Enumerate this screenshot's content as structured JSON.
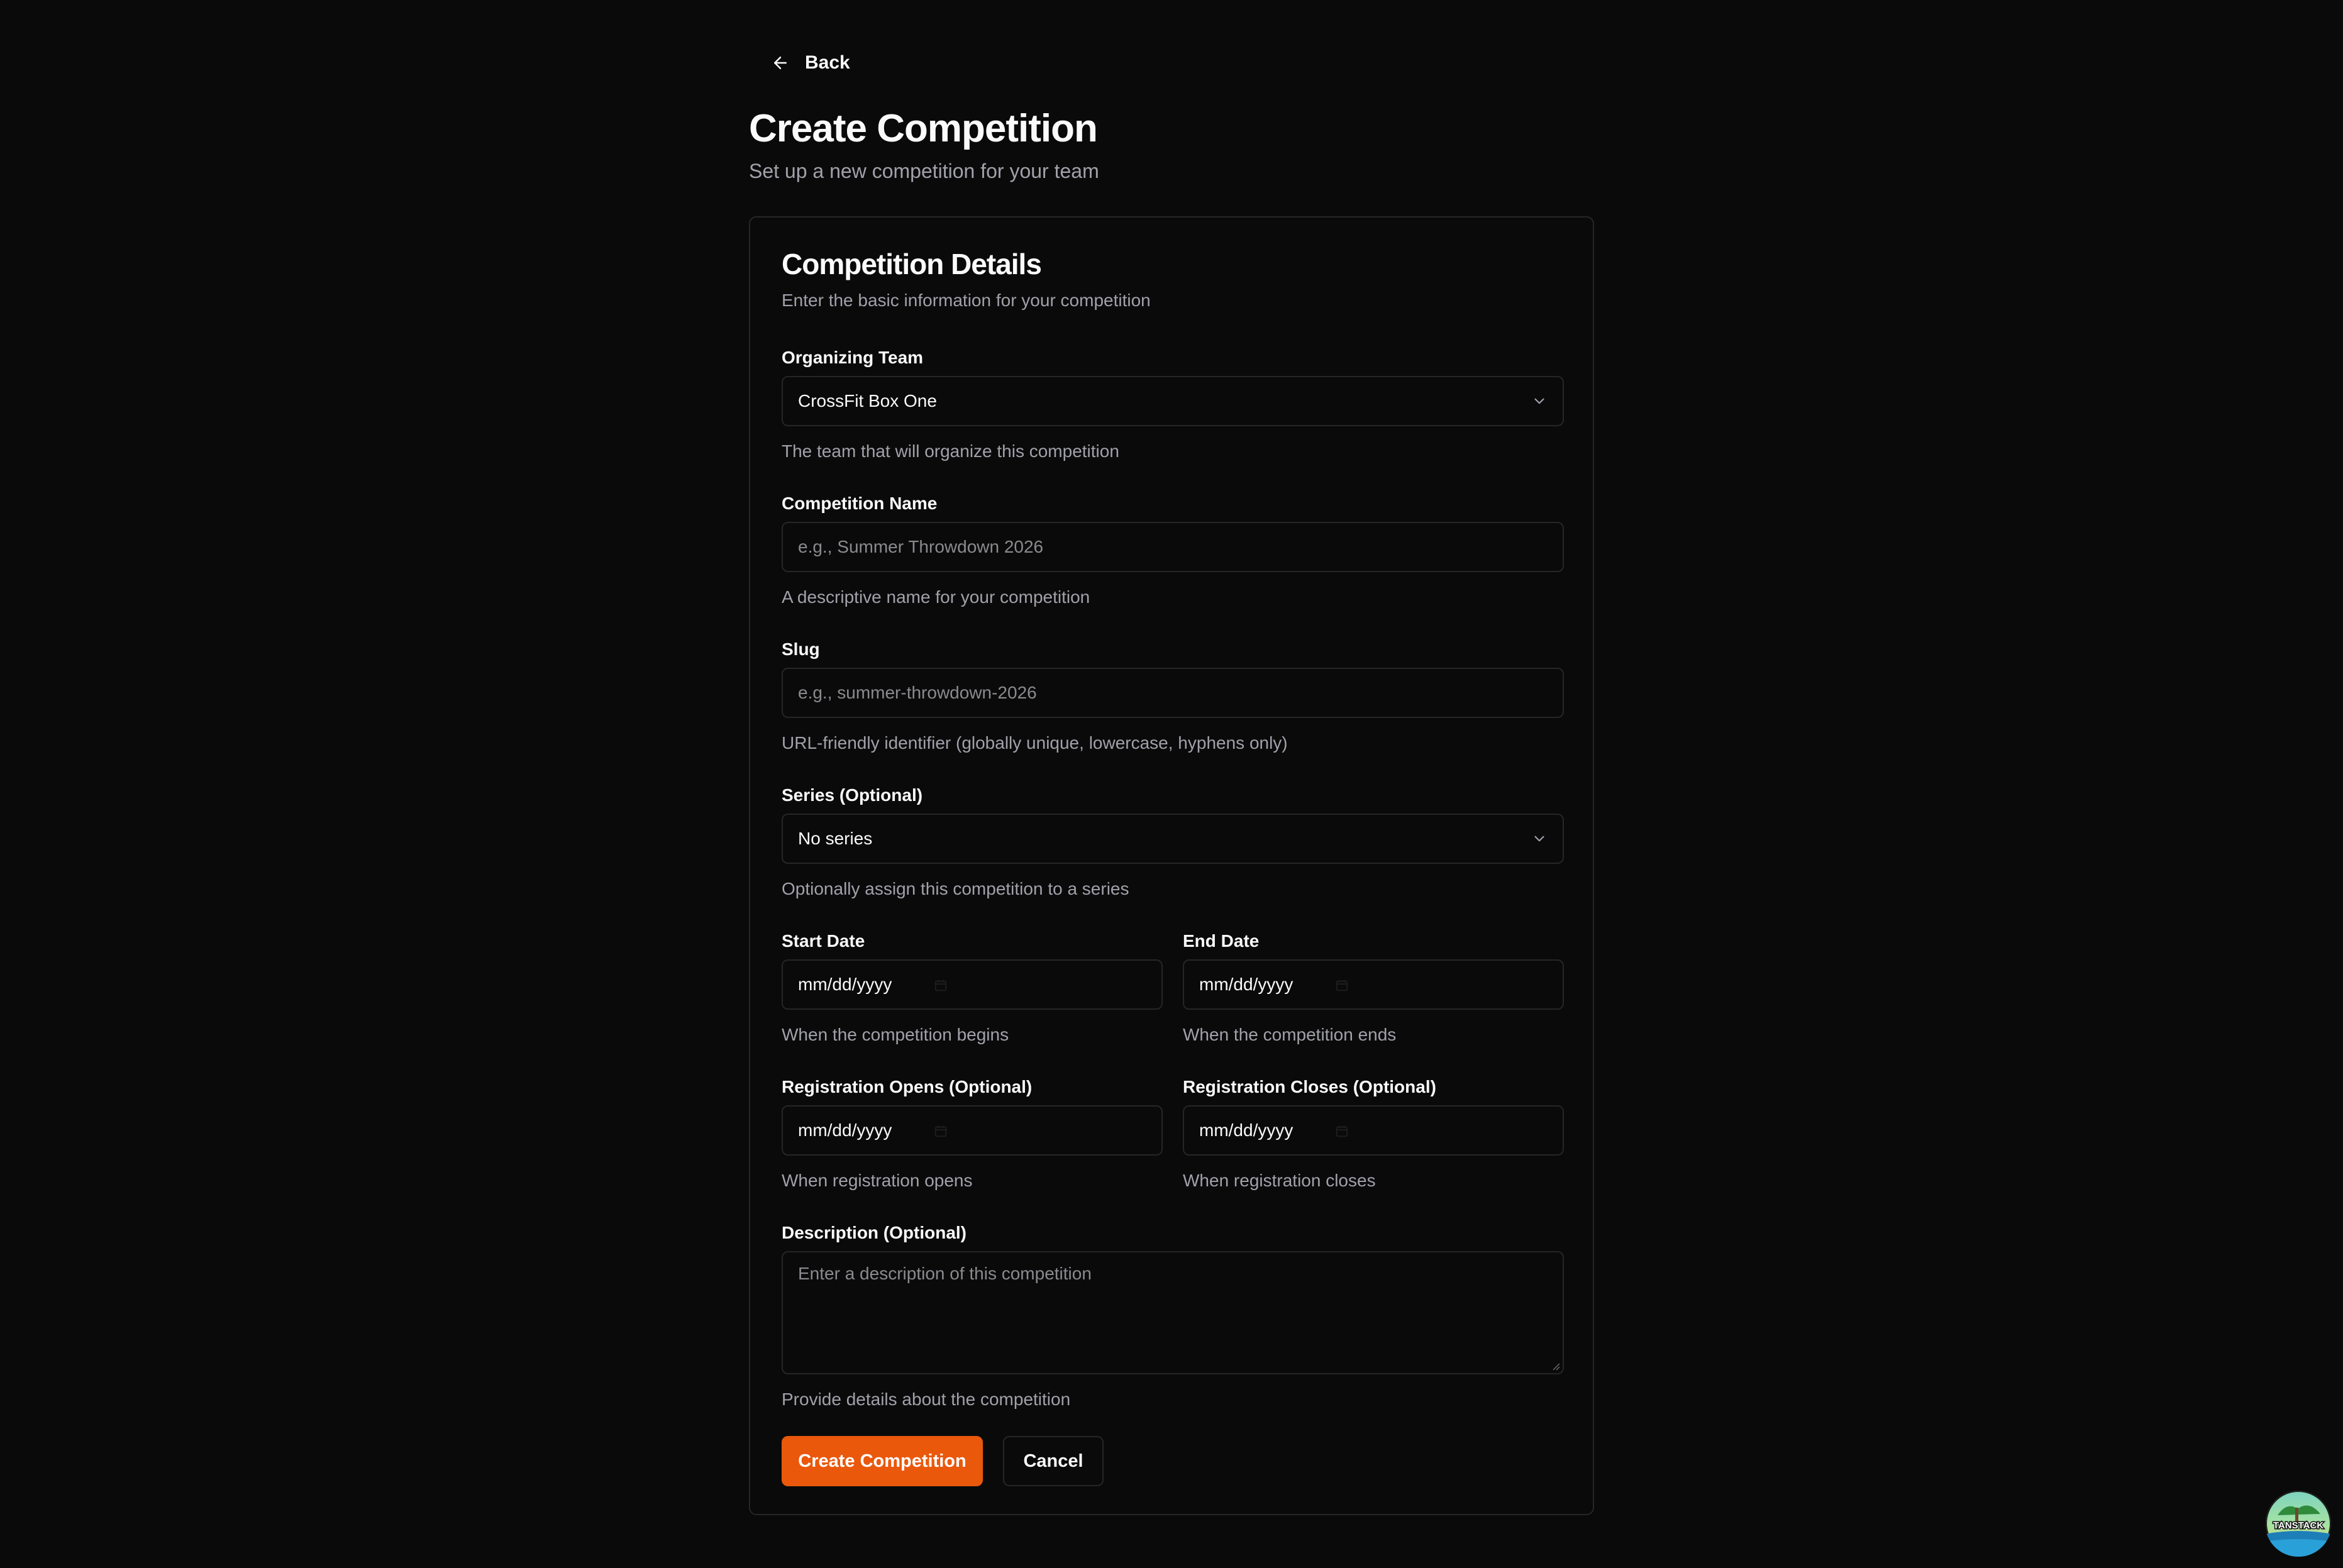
{
  "back": {
    "label": "Back"
  },
  "header": {
    "title": "Create Competition",
    "subtitle": "Set up a new competition for your team"
  },
  "card": {
    "title": "Competition Details",
    "description": "Enter the basic information for your competition"
  },
  "fields": {
    "organizing_team": {
      "label": "Organizing Team",
      "value": "CrossFit Box One",
      "help": "The team that will organize this competition"
    },
    "competition_name": {
      "label": "Competition Name",
      "placeholder": "e.g., Summer Throwdown 2026",
      "help": "A descriptive name for your competition"
    },
    "slug": {
      "label": "Slug",
      "placeholder": "e.g., summer-throwdown-2026",
      "help": "URL-friendly identifier (globally unique, lowercase, hyphens only)"
    },
    "series": {
      "label": "Series (Optional)",
      "value": "No series",
      "help": "Optionally assign this competition to a series"
    },
    "start_date": {
      "label": "Start Date",
      "value": "mm/dd/yyyy",
      "help": "When the competition begins"
    },
    "end_date": {
      "label": "End Date",
      "value": "mm/dd/yyyy",
      "help": "When the competition ends"
    },
    "registration_opens": {
      "label": "Registration Opens (Optional)",
      "value": "mm/dd/yyyy",
      "help": "When registration opens"
    },
    "registration_closes": {
      "label": "Registration Closes (Optional)",
      "value": "mm/dd/yyyy",
      "help": "When registration closes"
    },
    "description": {
      "label": "Description (Optional)",
      "placeholder": "Enter a description of this competition",
      "help": "Provide details about the competition"
    }
  },
  "actions": {
    "create_label": "Create Competition",
    "cancel_label": "Cancel"
  },
  "devtools": {
    "logo_text": "TANSTACK"
  },
  "colors": {
    "background": "#0a0a0a",
    "border": "#262626",
    "text": "#fafafa",
    "muted": "#a1a1aa",
    "accent": "#ea580c"
  },
  "icons": {
    "back": "arrow-left-icon",
    "select": "chevron-down-icon",
    "date": "calendar-icon"
  }
}
